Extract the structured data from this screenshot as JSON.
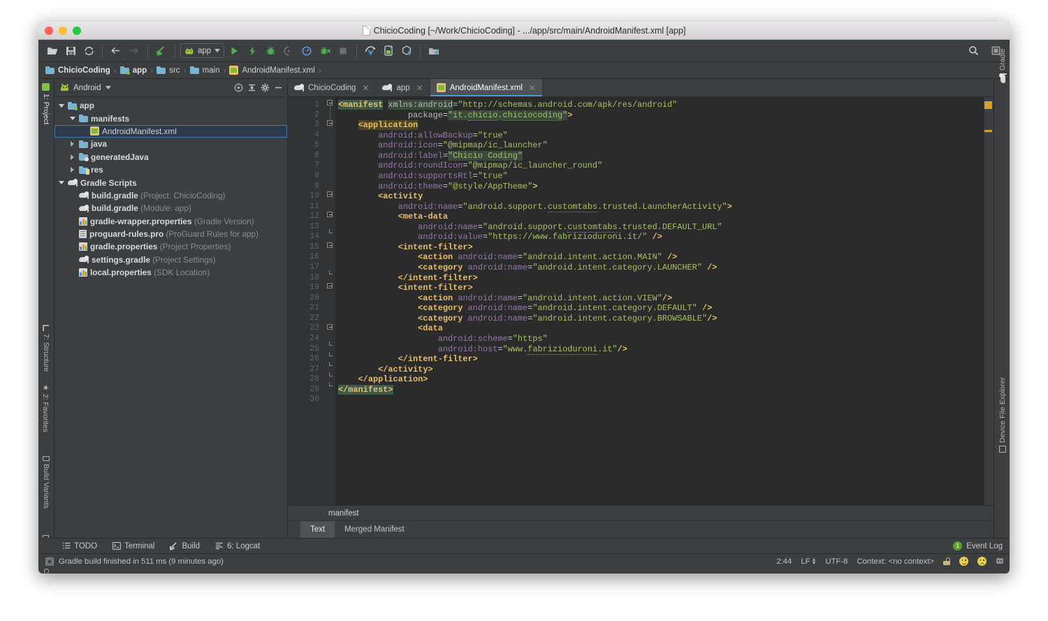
{
  "window": {
    "title": "ChicioCoding [~/Work/ChicioCoding] - .../app/src/main/AndroidManifest.xml [app]"
  },
  "toolbar": {
    "icons": [
      "open-folder-icon",
      "save-all-icon",
      "sync-icon",
      "back-arrow-icon",
      "forward-arrow-icon",
      "undo-icon"
    ],
    "run_config_label": "app",
    "run_icons": [
      "run-icon",
      "apply-changes-icon",
      "debug-icon",
      "debug-attach-icon",
      "profiler-icon",
      "instant-run-icon",
      "stop-icon"
    ],
    "sdk_icons": [
      "avd-manager-icon",
      "sdk-manager-icon",
      "sync-project-icon",
      "project-structure-icon"
    ],
    "search_icon": "search-icon",
    "layout_icon": "layout-inspector-icon"
  },
  "breadcrumb": {
    "items": [
      {
        "label": "ChicioCoding",
        "icon": "module-folder-icon"
      },
      {
        "label": "app",
        "icon": "app-folder-icon"
      },
      {
        "label": "src",
        "icon": "folder-icon"
      },
      {
        "label": "main",
        "icon": "folder-icon"
      },
      {
        "label": "AndroidManifest.xml",
        "icon": "xml-file-icon"
      }
    ]
  },
  "left_tool_strip": {
    "items": [
      {
        "label": "1: Project",
        "active": true
      },
      {
        "label": "7: Structure",
        "active": false
      },
      {
        "label": "2: Favorites",
        "active": false
      },
      {
        "label": "Build Variants",
        "active": false
      },
      {
        "label": "Layout Captures",
        "active": false
      }
    ]
  },
  "right_tool_strip": {
    "items": [
      {
        "label": "Gradle"
      },
      {
        "label": "Device File Explorer"
      }
    ]
  },
  "project_panel": {
    "view_label": "Android",
    "header_icons": [
      "target-icon",
      "collapse-all-icon",
      "settings-gear-icon",
      "hide-icon"
    ],
    "tree": [
      {
        "label": "app",
        "detail": "",
        "depth": 0,
        "state": "expanded",
        "icon": "app-folder-icon",
        "selected": false
      },
      {
        "label": "manifests",
        "detail": "",
        "depth": 1,
        "state": "expanded",
        "icon": "folder-icon",
        "selected": false
      },
      {
        "label": "AndroidManifest.xml",
        "detail": "",
        "depth": 2,
        "state": "leaf",
        "icon": "xml-file-icon",
        "selected": true
      },
      {
        "label": "java",
        "detail": "",
        "depth": 1,
        "state": "collapsed",
        "icon": "folder-icon",
        "selected": false
      },
      {
        "label": "generatedJava",
        "detail": "",
        "depth": 1,
        "state": "collapsed",
        "icon": "generated-folder-icon",
        "selected": false
      },
      {
        "label": "res",
        "detail": "",
        "depth": 1,
        "state": "collapsed",
        "icon": "res-folder-icon",
        "selected": false
      },
      {
        "label": "Gradle Scripts",
        "detail": "",
        "depth": 0,
        "state": "expanded",
        "icon": "gradle-icon",
        "selected": false
      },
      {
        "label": "build.gradle",
        "detail": "(Project: ChicioCoding)",
        "depth": 1,
        "state": "leaf",
        "icon": "gradle-icon",
        "selected": false
      },
      {
        "label": "build.gradle",
        "detail": "(Module: app)",
        "depth": 1,
        "state": "leaf",
        "icon": "gradle-icon",
        "selected": false
      },
      {
        "label": "gradle-wrapper.properties",
        "detail": "(Gradle Version)",
        "depth": 1,
        "state": "leaf",
        "icon": "properties-icon",
        "selected": false
      },
      {
        "label": "proguard-rules.pro",
        "detail": "(ProGuard Rules for app)",
        "depth": 1,
        "state": "leaf",
        "icon": "document-icon",
        "selected": false
      },
      {
        "label": "gradle.properties",
        "detail": "(Project Properties)",
        "depth": 1,
        "state": "leaf",
        "icon": "properties-icon",
        "selected": false
      },
      {
        "label": "settings.gradle",
        "detail": "(Project Settings)",
        "depth": 1,
        "state": "leaf",
        "icon": "gradle-icon",
        "selected": false
      },
      {
        "label": "local.properties",
        "detail": "(SDK Location)",
        "depth": 1,
        "state": "leaf",
        "icon": "properties-icon",
        "selected": false
      }
    ]
  },
  "editor": {
    "tabs": [
      {
        "label": "ChicioCoding",
        "icon": "gradle-icon",
        "active": false,
        "closable": true
      },
      {
        "label": "app",
        "icon": "gradle-icon",
        "active": false,
        "closable": true
      },
      {
        "label": "AndroidManifest.xml",
        "icon": "xml-file-icon",
        "active": true,
        "closable": true
      }
    ],
    "breadcrumb": "manifest",
    "bottom_tabs": [
      {
        "label": "Text",
        "active": true
      },
      {
        "label": "Merged Manifest",
        "active": false
      }
    ],
    "total_lines": 30,
    "lines": [
      {
        "n": 1,
        "indent": 0,
        "html": "<span class=\"tag hlsel\">&lt;manifest</span> <span class=\"ns hl\">xmlns:android</span><span class=\"punc\">=</span><span class=\"val\">\"http://schemas.android.com/apk/res/android\"</span>"
      },
      {
        "n": 2,
        "indent": 0,
        "html": "              <span class=\"ns\">package</span><span class=\"punc\">=</span><span class=\"val hl\">\"it.<span class=\"squig\">chicio</span>.<span class=\"squig\">chiciocoding</span>\"</span><span class=\"tag\">&gt;</span>"
      },
      {
        "n": 3,
        "indent": 0,
        "html": "    <span class=\"tag hlo\">&lt;application</span>"
      },
      {
        "n": 4,
        "indent": 0,
        "html": "        <span class=\"attr\">android:allowBackup</span><span class=\"punc\">=</span><span class=\"val\">\"true\"</span>"
      },
      {
        "n": 5,
        "indent": 0,
        "html": "        <span class=\"attr\">android:icon</span><span class=\"punc\">=</span><span class=\"val\">\"@mipmap/ic_launcher\"</span>"
      },
      {
        "n": 6,
        "indent": 0,
        "html": "        <span class=\"attr\">android:label</span><span class=\"punc\">=</span><span class=\"val hl\">\"Chicio Coding\"</span>"
      },
      {
        "n": 7,
        "indent": 0,
        "html": "        <span class=\"attr\">android:roundIcon</span><span class=\"punc\">=</span><span class=\"val\">\"@mipmap/ic_launcher_round\"</span>"
      },
      {
        "n": 8,
        "indent": 0,
        "html": "        <span class=\"attr\">android:supportsRtl</span><span class=\"punc\">=</span><span class=\"val\">\"true\"</span>"
      },
      {
        "n": 9,
        "indent": 0,
        "html": "        <span class=\"attr\">android:theme</span><span class=\"punc\">=</span><span class=\"val\">\"@style/AppTheme\"</span><span class=\"tag\">&gt;</span>"
      },
      {
        "n": 10,
        "indent": 0,
        "html": "        <span class=\"tag\">&lt;activity</span>"
      },
      {
        "n": 11,
        "indent": 0,
        "html": "            <span class=\"attr\">android:name</span><span class=\"punc\">=</span><span class=\"val\">\"android.support.<span class=\"squig\">customtabs</span>.trusted.LauncherActivity\"</span><span class=\"tag\">&gt;</span>"
      },
      {
        "n": 12,
        "indent": 0,
        "html": "            <span class=\"tag\">&lt;meta-data</span>"
      },
      {
        "n": 13,
        "indent": 0,
        "html": "                <span class=\"attr\">android:name</span><span class=\"punc\">=</span><span class=\"val\">\"android.support.<span class=\"squig\">customtabs</span>.trusted.DEFAULT_URL\"</span>"
      },
      {
        "n": 14,
        "indent": 0,
        "html": "                <span class=\"attr\">android:value</span><span class=\"punc\">=</span><span class=\"val\">\"https://www.fabrizioduroni.it/\"</span> <span class=\"tag\">/&gt;</span>"
      },
      {
        "n": 15,
        "indent": 0,
        "html": "            <span class=\"tag\">&lt;intent-filter&gt;</span>"
      },
      {
        "n": 16,
        "indent": 0,
        "html": "                <span class=\"tag\">&lt;action</span> <span class=\"attr\">android:name</span><span class=\"punc\">=</span><span class=\"val\">\"android.intent.action.MAIN\"</span> <span class=\"tag\">/&gt;</span>"
      },
      {
        "n": 17,
        "indent": 0,
        "html": "                <span class=\"tag\">&lt;category</span> <span class=\"attr\">android:name</span><span class=\"punc\">=</span><span class=\"val\">\"android.intent.category.LAUNCHER\"</span> <span class=\"tag\">/&gt;</span>"
      },
      {
        "n": 18,
        "indent": 0,
        "html": "            <span class=\"tag\">&lt;/intent-filter&gt;</span>"
      },
      {
        "n": 19,
        "indent": 0,
        "html": "            <span class=\"tag\">&lt;intent-filter&gt;</span>"
      },
      {
        "n": 20,
        "indent": 0,
        "html": "                <span class=\"tag\">&lt;action</span> <span class=\"attr\">android:name</span><span class=\"punc\">=</span><span class=\"val\">\"android.intent.action.VIEW\"</span><span class=\"tag\">/&gt;</span>"
      },
      {
        "n": 21,
        "indent": 0,
        "html": "                <span class=\"tag\">&lt;category</span> <span class=\"attr\">android:name</span><span class=\"punc\">=</span><span class=\"val\">\"android.intent.category.DEFAULT\"</span> <span class=\"tag\">/&gt;</span>"
      },
      {
        "n": 22,
        "indent": 0,
        "html": "                <span class=\"tag\">&lt;category</span> <span class=\"attr\">android:name</span><span class=\"punc\">=</span><span class=\"val\">\"android.intent.category.BROWSABLE\"</span><span class=\"tag\">/&gt;</span>"
      },
      {
        "n": 23,
        "indent": 0,
        "html": "                <span class=\"tag\">&lt;data</span>"
      },
      {
        "n": 24,
        "indent": 0,
        "html": "                    <span class=\"attr\">android:scheme</span><span class=\"punc\">=</span><span class=\"val\">\"https\"</span>"
      },
      {
        "n": 25,
        "indent": 0,
        "html": "                    <span class=\"attr\">android:host</span><span class=\"punc\">=</span><span class=\"val\">\"www.<span class=\"squig\">fabrizioduroni</span>.it\"</span><span class=\"tag\">/&gt;</span>"
      },
      {
        "n": 26,
        "indent": 0,
        "html": "            <span class=\"tag\">&lt;/intent-filter&gt;</span>"
      },
      {
        "n": 27,
        "indent": 0,
        "html": "        <span class=\"tag\">&lt;/activity&gt;</span>"
      },
      {
        "n": 28,
        "indent": 0,
        "html": "    <span class=\"tag\">&lt;/application&gt;</span>"
      },
      {
        "n": 29,
        "indent": 0,
        "html": "<span class=\"tag hlsel\">&lt;/manifest&gt;</span>"
      },
      {
        "n": 30,
        "indent": 0,
        "html": ""
      }
    ]
  },
  "bottom_strip": {
    "items": [
      {
        "label": "TODO",
        "icon": "todo-icon"
      },
      {
        "label": "Terminal",
        "icon": "terminal-icon"
      },
      {
        "label": "Build",
        "icon": "build-hammer-icon"
      },
      {
        "label": "6: Logcat",
        "icon": "logcat-icon"
      }
    ],
    "event_log_label": "Event Log",
    "event_log_count": "1"
  },
  "status_bar": {
    "message": "Gradle build finished in 511 ms (9 minutes ago)",
    "caret_position": "2:44",
    "line_separator": "LF",
    "encoding": "UTF-8",
    "context": "Context: <no context>",
    "icons": [
      "lock-icon",
      "happy-face-icon",
      "sad-face-icon",
      "robot-icon"
    ]
  },
  "colors": {
    "accent_blue": "#4a9bd4",
    "panel_bg": "#3c3f41",
    "editor_bg": "#2b2b2b",
    "gutter_bg": "#313335",
    "selection_blue": "#2d3a4a",
    "green_run": "#4caf50",
    "marker_orange": "#d8a128"
  }
}
